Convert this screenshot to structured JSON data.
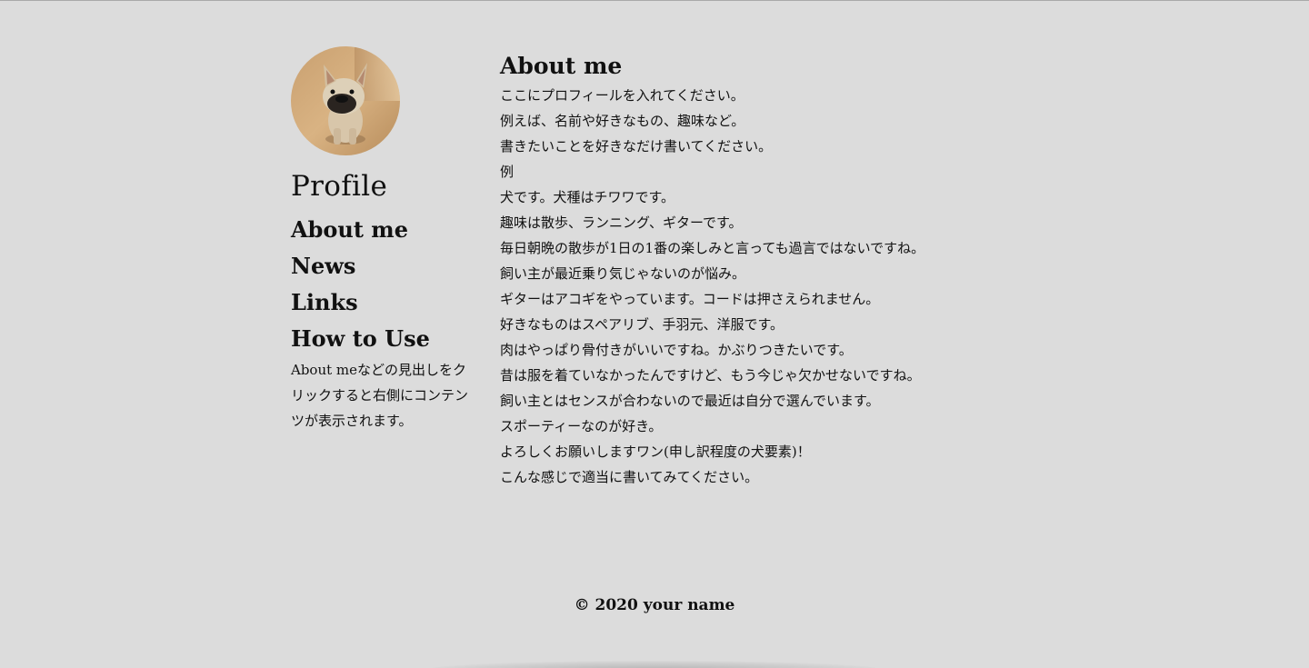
{
  "sidebar": {
    "avatar_alt": "French bulldog photo",
    "title": "Profile",
    "nav": [
      {
        "label": "About me"
      },
      {
        "label": "News"
      },
      {
        "label": "Links"
      },
      {
        "label": "How to Use"
      }
    ],
    "hint": "About meなどの見出しをクリックすると右側にコンテンツが表示されます。"
  },
  "main": {
    "heading": "About me",
    "lines": [
      "ここにプロフィールを入れてください。",
      "例えば、名前や好きなもの、趣味など。",
      "書きたいことを好きなだけ書いてください。",
      "例",
      "犬です。犬種はチワワです。",
      "趣味は散歩、ランニング、ギターです。",
      "毎日朝晩の散歩が1日の1番の楽しみと言っても過言ではないですね。",
      "飼い主が最近乗り気じゃないのが悩み。",
      "ギターはアコギをやっています。コードは押さえられません。",
      "好きなものはスペアリブ、手羽元、洋服です。",
      "肉はやっぱり骨付きがいいですね。かぶりつきたいです。",
      "昔は服を着ていなかったんですけど、もう今じゃ欠かせないですね。",
      "飼い主とはセンスが合わないので最近は自分で選んでいます。",
      "スポーティーなのが好き。",
      "よろしくお願いしますワン(申し訳程度の犬要素)！",
      "こんな感じで適当に書いてみてください。"
    ]
  },
  "footer": {
    "copyright": "© 2020 your name"
  },
  "colors": {
    "background": "#dcdcdc",
    "text": "#111111"
  }
}
